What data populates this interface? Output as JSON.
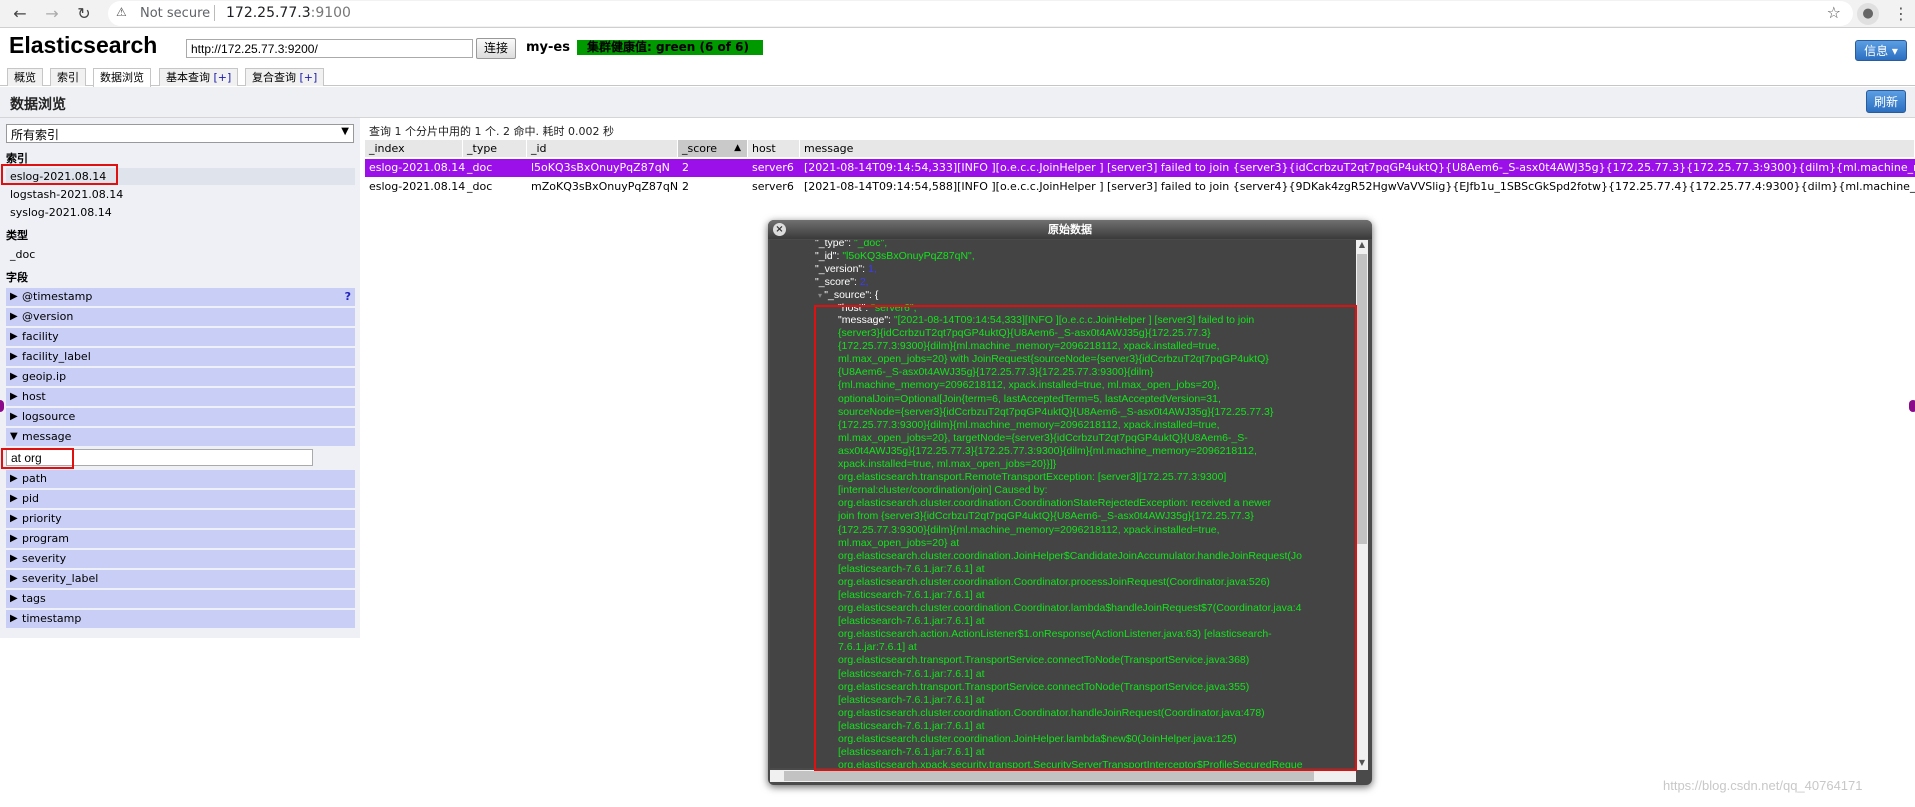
{
  "browser": {
    "security_label": "Not secure",
    "url_host": "172.25.77.3",
    "url_port": ":9100"
  },
  "header": {
    "title": "Elasticsearch",
    "cluster_url": "http://172.25.77.3:9200/",
    "connect_label": "连接",
    "cluster_name": "my-es",
    "health_text": "集群健康值: green (6 of 6)",
    "info_label": "信息 ▾",
    "health_color": "#009900"
  },
  "tabs": [
    {
      "label": "概览"
    },
    {
      "label": "索引"
    },
    {
      "label": "数据浏览"
    },
    {
      "label": "基本查询",
      "plus": "[+]"
    },
    {
      "label": "复合查询",
      "plus": "[+]"
    }
  ],
  "page": {
    "title": "数据浏览",
    "refresh_label": "刷新"
  },
  "sidebar": {
    "index_select_value": "所有索引",
    "indices_heading": "索引",
    "indices": [
      "eslog-2021.08.14",
      "logstash-2021.08.14",
      "syslog-2021.08.14"
    ],
    "types_heading": "类型",
    "types": [
      "_doc"
    ],
    "fields_heading": "字段",
    "fields": [
      "@timestamp",
      "@version",
      "facility",
      "facility_label",
      "geoip.ip",
      "host",
      "logsource",
      "message",
      "path",
      "pid",
      "priority",
      "program",
      "severity",
      "severity_label",
      "tags",
      "timestamp"
    ],
    "help_mark": "?",
    "filter_value": "at org"
  },
  "results": {
    "summary": "查询 1 个分片中用的 1 个. 2 命中. 耗时 0.002 秒",
    "columns": [
      "_index",
      "_type",
      "_id",
      "_score",
      "host",
      "message"
    ],
    "sort_indicator": "▲",
    "rows": [
      {
        "index": "eslog-2021.08.14",
        "type": "_doc",
        "id": "l5oKQ3sBxOnuyPqZ87qN",
        "score": "2",
        "host": "server6",
        "message": "[2021-08-14T09:14:54,333][INFO ][o.e.c.c.JoinHelper ] [server3] failed to join {server3}{idCcrbzuT2qt7pqGP4uktQ}{U8Aem6-_S-asx0t4AWJ35g}{172.25.77.3}{172.25.77.3:9300}{dilm}{ml.machine_memory=2096218"
      },
      {
        "index": "eslog-2021.08.14",
        "type": "_doc",
        "id": "mZoKQ3sBxOnuyPqZ87qN",
        "score": "2",
        "host": "server6",
        "message": "[2021-08-14T09:14:54,588][INFO ][o.e.c.c.JoinHelper ] [server3] failed to join {server4}{9DKak4zgR52HgwVaVVSlig}{EJfb1u_1SBScGkSpd2fotw}{172.25.77.4}{172.25.77.4:9300}{dilm}{ml.machine_memory=20962"
      }
    ]
  },
  "modal": {
    "title": "原始数据",
    "close_icon": "×",
    "json_lines": [
      {
        "key": "\"_type\": ",
        "val": "\"_doc\","
      },
      {
        "key": "\"_id\": ",
        "val": "\"l5oKQ3sBxOnuyPqZ87qN\","
      },
      {
        "key": "\"_version\": ",
        "val": "1,",
        "num": true
      },
      {
        "key": "\"_score\": ",
        "val": "2,",
        "num": true
      },
      {
        "key": "\"_source\": {",
        "val": ""
      },
      {
        "key": "\"host\": ",
        "val": "\"server6\","
      }
    ],
    "message_key": "\"message\": ",
    "message_lines": [
      "\"[2021-08-14T09:14:54,333][INFO ][o.e.c.c.JoinHelper ] [server3] failed to join",
      "{server3}{idCcrbzuT2qt7pqGP4uktQ}{U8Aem6-_S-asx0t4AWJ35g}{172.25.77.3}",
      "{172.25.77.3:9300}{dilm}{ml.machine_memory=2096218112, xpack.installed=true,",
      "ml.max_open_jobs=20} with JoinRequest{sourceNode={server3}{idCcrbzuT2qt7pqGP4uktQ}",
      "{U8Aem6-_S-asx0t4AWJ35g}{172.25.77.3}{172.25.77.3:9300}{dilm}",
      "{ml.machine_memory=2096218112, xpack.installed=true, ml.max_open_jobs=20},",
      "optionalJoin=Optional[Join{term=6, lastAcceptedTerm=5, lastAcceptedVersion=31,",
      "sourceNode={server3}{idCcrbzuT2qt7pqGP4uktQ}{U8Aem6-_S-asx0t4AWJ35g}{172.25.77.3}",
      "{172.25.77.3:9300}{dilm}{ml.machine_memory=2096218112, xpack.installed=true,",
      "ml.max_open_jobs=20}, targetNode={server3}{idCcrbzuT2qt7pqGP4uktQ}{U8Aem6-_S-",
      "asx0t4AWJ35g}{172.25.77.3}{172.25.77.3:9300}{dilm}{ml.machine_memory=2096218112,",
      "xpack.installed=true, ml.max_open_jobs=20}}]}",
      "org.elasticsearch.transport.RemoteTransportException: [server3][172.25.77.3:9300]",
      "[internal:cluster/coordination/join] Caused by:",
      "org.elasticsearch.cluster.coordination.CoordinationStateRejectedException: received a newer",
      "join from {server3}{idCcrbzuT2qt7pqGP4uktQ}{U8Aem6-_S-asx0t4AWJ35g}{172.25.77.3}",
      "{172.25.77.3:9300}{dilm}{ml.machine_memory=2096218112, xpack.installed=true,",
      "ml.max_open_jobs=20} at",
      "org.elasticsearch.cluster.coordination.JoinHelper$CandidateJoinAccumulator.handleJoinRequest(Jo",
      "[elasticsearch-7.6.1.jar:7.6.1] at",
      "org.elasticsearch.cluster.coordination.Coordinator.processJoinRequest(Coordinator.java:526)",
      "[elasticsearch-7.6.1.jar:7.6.1] at",
      "org.elasticsearch.cluster.coordination.Coordinator.lambda$handleJoinRequest$7(Coordinator.java:4",
      "[elasticsearch-7.6.1.jar:7.6.1] at",
      "org.elasticsearch.action.ActionListener$1.onResponse(ActionListener.java:63) [elasticsearch-",
      "7.6.1.jar:7.6.1] at",
      "org.elasticsearch.transport.TransportService.connectToNode(TransportService.java:368)",
      "[elasticsearch-7.6.1.jar:7.6.1] at",
      "org.elasticsearch.transport.TransportService.connectToNode(TransportService.java:355)",
      "[elasticsearch-7.6.1.jar:7.6.1] at",
      "org.elasticsearch.cluster.coordination.Coordinator.handleJoinRequest(Coordinator.java:478)",
      "[elasticsearch-7.6.1.jar:7.6.1] at",
      "org.elasticsearch.cluster.coordination.JoinHelper.lambda$new$0(JoinHelper.java:125)",
      "[elasticsearch-7.6.1.jar:7.6.1] at",
      "org.elasticsearch.xpack.security.transport.SecurityServerTransportInterceptor$ProfileSecuredReque"
    ]
  },
  "watermark": "https://blog.csdn.net/qq_40764171",
  "colors": {
    "selected_row": "#9b10e8",
    "json_string": "#13e41c",
    "json_number": "#3b3bff",
    "field_bg": "#c8cef6",
    "highlight_box": "#e01010"
  }
}
